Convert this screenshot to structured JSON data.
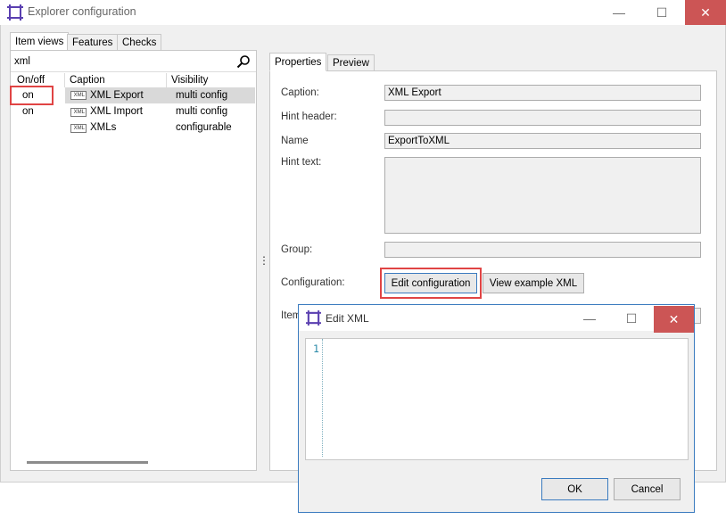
{
  "window": {
    "title": "Explorer configuration",
    "minimize": "—",
    "maximize": "☐",
    "close": "✕"
  },
  "left_tabs": [
    "Item views",
    "Features",
    "Checks"
  ],
  "search": {
    "value": "xml"
  },
  "list": {
    "columns": [
      "On/off",
      "Caption",
      "Visibility"
    ],
    "rows": [
      {
        "onoff": "on",
        "caption": "XML Export",
        "visibility": "multi config"
      },
      {
        "onoff": "on",
        "caption": "XML Import",
        "visibility": "multi config"
      },
      {
        "onoff": "",
        "caption": "XMLs",
        "visibility": "configurable"
      }
    ]
  },
  "splitter": "⋮",
  "right_tabs": [
    "Properties",
    "Preview"
  ],
  "properties": {
    "caption_label": "Caption:",
    "caption_value": "XML Export",
    "hint_header_label": "Hint header:",
    "hint_header_value": "",
    "name_label": "Name",
    "name_value": "ExportToXML",
    "hint_text_label": "Hint text:",
    "hint_text_value": "",
    "group_label": "Group:",
    "group_value": "",
    "configuration_label": "Configuration:",
    "edit_configuration": "Edit configuration",
    "view_example_xml": "View example XML",
    "item_label_partial": "Item"
  },
  "dialog": {
    "title": "Edit XML",
    "minimize": "—",
    "maximize": "☐",
    "close": "✕",
    "line_number": "1",
    "ok": "OK",
    "cancel": "Cancel"
  },
  "icons": {
    "app": "app-frame-icon",
    "search": "search-icon",
    "xml_item": "xml-file-icon"
  },
  "colors": {
    "highlight": "#e04444",
    "close_hover": "#cc5555",
    "dialog_border": "#3b7bbf",
    "selected_row": "#d9d9d9"
  }
}
